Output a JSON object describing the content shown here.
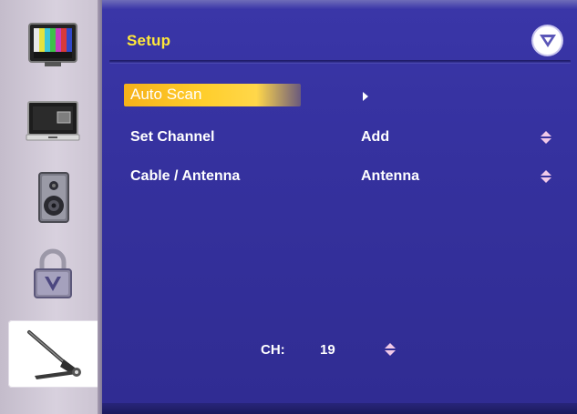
{
  "menu": {
    "title": "Setup",
    "items": [
      {
        "label": "Auto Scan",
        "value": "",
        "selected": true,
        "control": "submenu"
      },
      {
        "label": "Set Channel",
        "value": "Add",
        "selected": false,
        "control": "up-down"
      },
      {
        "label": "Cable / Antenna",
        "value": "Antenna",
        "selected": false,
        "control": "up-down"
      }
    ]
  },
  "channel": {
    "label": "CH:",
    "value": "19"
  },
  "sidebar": {
    "items": [
      {
        "icon": "tv-picture-icon",
        "active": false
      },
      {
        "icon": "computer-monitor-icon",
        "active": false
      },
      {
        "icon": "audio-speaker-icon",
        "active": false
      },
      {
        "icon": "parental-lock-icon",
        "active": false
      },
      {
        "icon": "setup-wrench-icon",
        "active": true
      }
    ]
  },
  "colors": {
    "panel_bg": "#36329f",
    "title_yellow": "#ffe83a",
    "highlight": "#ffce2c",
    "sidebar_bg": "#d8d1de",
    "text": "#ffffff",
    "arrow": "#ffffff",
    "updown_icon": "#f1c9e8"
  }
}
